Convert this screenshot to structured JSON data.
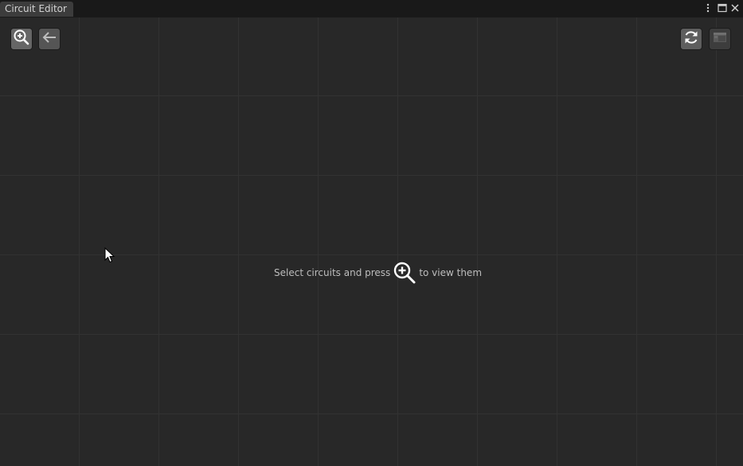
{
  "window": {
    "tab_title": "Circuit Editor",
    "title_icons": [
      "more-vertical-icon",
      "maximize-icon",
      "close-icon"
    ]
  },
  "toolbar": {
    "left_buttons": [
      "zoom-in-icon",
      "back-arrow-icon"
    ],
    "right_buttons": [
      "refresh-icon",
      "panel-toggle-icon"
    ]
  },
  "canvas": {
    "hint_before": "Select circuits and press",
    "hint_icon": "zoom-in-icon",
    "hint_after": "to view them"
  },
  "colors": {
    "background": "#282828",
    "grid_line": "#323232",
    "titlebar": "#191919",
    "tab": "#3c3c3c",
    "text": "#bdbdbd"
  }
}
